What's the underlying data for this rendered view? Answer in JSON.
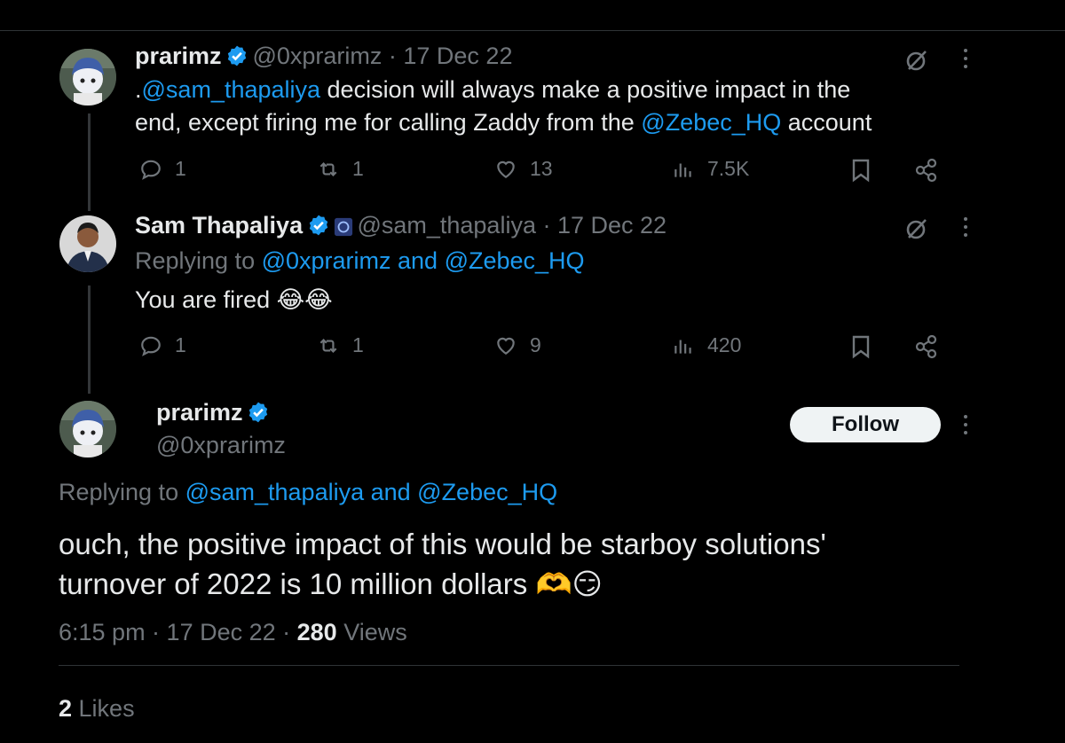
{
  "tweet1": {
    "name": "prarimz",
    "handle_date": "@0xprarimz · 17 Dec 22",
    "text_prefix": ".",
    "mention1": "@sam_thapaliya",
    "text_mid": " decision will always make a positive impact in the",
    "line2_prefix": "end, except firing me for calling Zaddy from the ",
    "mention2": "@Zebec_HQ",
    "line2_suffix": " account",
    "replies": "1",
    "retweets": "1",
    "likes": "13",
    "views": "7.5K"
  },
  "tweet2": {
    "name": "Sam Thapaliya",
    "handle_date": "@sam_thapaliya · 17 Dec 22",
    "replying_prefix": "Replying to ",
    "replying_mentions": "@0xprarimz and @Zebec_HQ",
    "text": "You are fired 😂😂",
    "replies": "1",
    "retweets": "1",
    "likes": "9",
    "views": "420"
  },
  "tweet3": {
    "name": "prarimz",
    "handle": "@0xprarimz",
    "follow_label": "Follow",
    "replying_prefix": "Replying to ",
    "replying_mentions": "@sam_thapaliya and @Zebec_HQ",
    "line1": "ouch, the positive impact of this would be starboy solutions'",
    "line2": "turnover of 2022 is 10 million dollars 🫶😏",
    "time": "6:15 pm · 17 Dec 22 · ",
    "views_count": "280",
    "views_label": " Views",
    "likes_count": "2",
    "likes_label": " Likes"
  },
  "colors": {
    "accent": "#1d9bf0",
    "muted": "#71767b",
    "text": "#e7e9ea",
    "bg": "#000000"
  },
  "icons": [
    "verified-badge-icon",
    "reply-icon",
    "retweet-icon",
    "like-icon",
    "views-icon",
    "bookmark-icon",
    "share-icon",
    "grok-icon",
    "more-icon",
    "community-icon"
  ]
}
